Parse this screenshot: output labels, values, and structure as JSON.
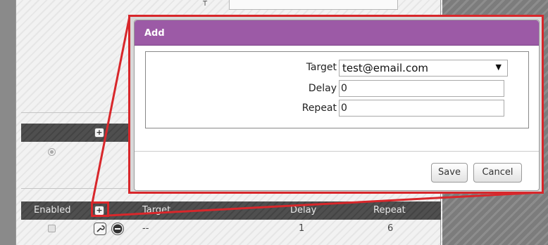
{
  "background": {
    "top_field_label": "T",
    "top_field_value": "",
    "table": {
      "headers": {
        "enabled": "Enabled",
        "target": "Target",
        "delay": "Delay",
        "repeat": "Repeat"
      },
      "rows": [
        {
          "enabled": false,
          "target": "--",
          "delay": "1",
          "repeat": "6"
        }
      ]
    }
  },
  "modal": {
    "title": "Add",
    "fields": {
      "target_label": "Target",
      "target_value": "test@email.com",
      "delay_label": "Delay",
      "delay_value": "0",
      "repeat_label": "Repeat",
      "repeat_value": "0"
    },
    "buttons": {
      "save": "Save",
      "cancel": "Cancel"
    }
  },
  "colors": {
    "modal_header": "#9c5aa6",
    "callout_red": "#d8272b"
  },
  "icons": {
    "add": "plus-circle-icon",
    "edit": "wrench-icon",
    "remove": "minus-circle-icon",
    "dropdown": "triangle-down-icon"
  }
}
